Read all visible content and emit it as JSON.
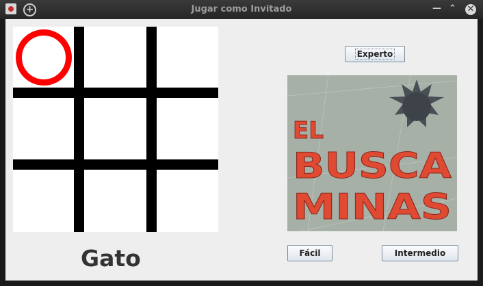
{
  "window": {
    "title": "Jugar como Invitado"
  },
  "left_panel": {
    "game_label": "Gato",
    "board": {
      "marks": [
        [
          "O",
          "",
          ""
        ],
        [
          "",
          "",
          ""
        ],
        [
          "",
          "",
          ""
        ]
      ]
    }
  },
  "right_panel": {
    "logo": {
      "lines": [
        "EL",
        "BUSCA",
        "MINAS"
      ]
    },
    "buttons": {
      "expert": "Experto",
      "easy": "Fácil",
      "intermediate": "Intermedio"
    }
  }
}
